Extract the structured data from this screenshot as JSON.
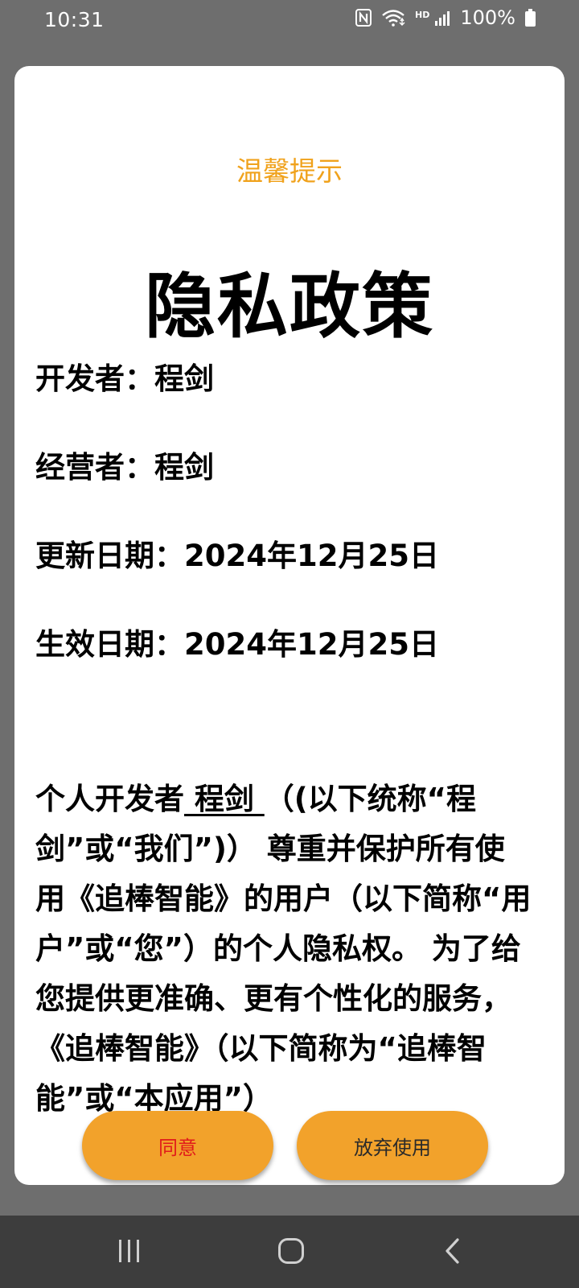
{
  "status_bar": {
    "time": "10:31",
    "hd": "HD",
    "battery_text": "100%",
    "icons": [
      "nfc-icon",
      "wifi-icon",
      "signal-icon",
      "battery-icon"
    ]
  },
  "dialog": {
    "title": "温馨提示",
    "heading": "隐私政策",
    "developer": "开发者：程剑",
    "operator": "经营者：程剑",
    "updated": "更新日期：2024年12月25日",
    "effective": "生效日期：2024年12月25日",
    "body": {
      "prefix": "个人开发者",
      "name": " 程剑 ",
      "suffix": "（(以下统称“程剑”或“我们”)） 尊重并保护所有使用《追棒智能》的用户（以下简称“用户”或“您”）的个人隐私权。 为了给您提供更准确、更有个性化的服务，《追棒智能》（以下简称为“追棒智能”或“本应用”）"
    }
  },
  "buttons": {
    "agree": "同意",
    "decline": "放弃使用"
  },
  "colors": {
    "accent": "#f0a21c",
    "button_bg": "#f2a22b",
    "agree_text": "#e11b1b",
    "backdrop": "#6e6e6e",
    "nav_bg": "#3d3d3d"
  },
  "nav_bar": {
    "icons": [
      "recent-apps-icon",
      "home-icon",
      "back-icon"
    ]
  }
}
